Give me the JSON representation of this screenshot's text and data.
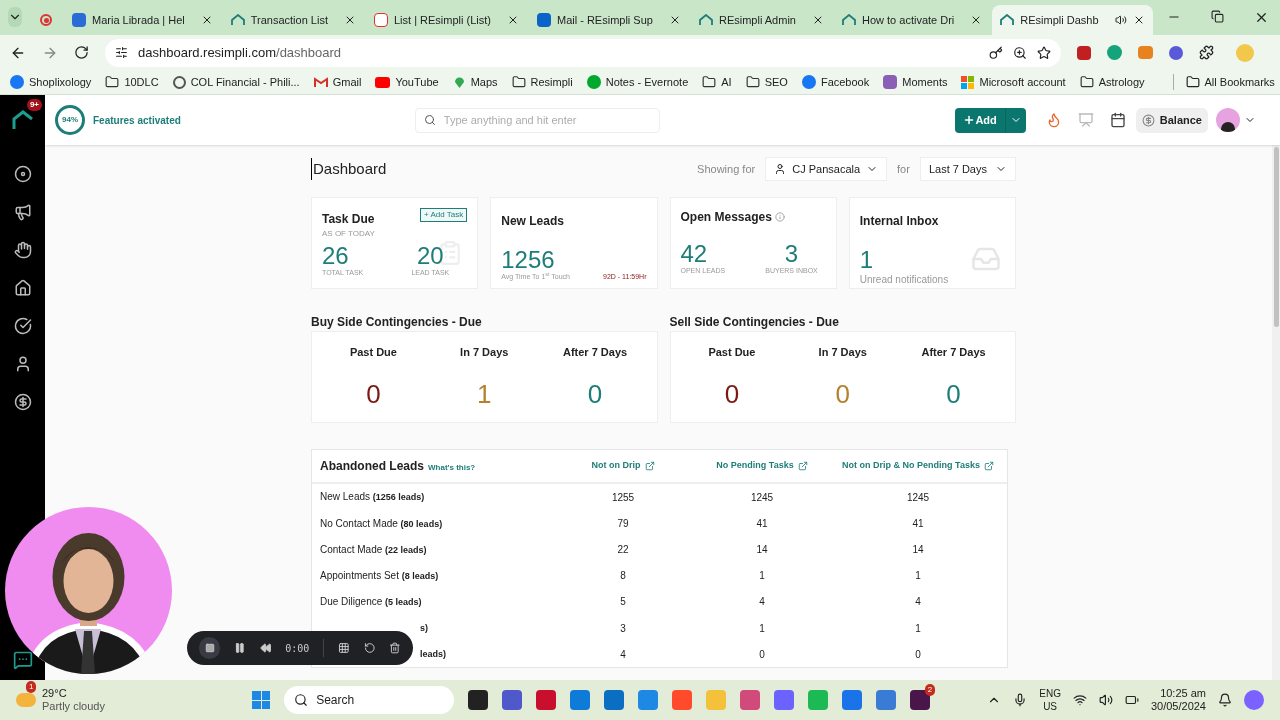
{
  "browser": {
    "tabs": [
      {
        "kind": "record",
        "selected": false
      },
      {
        "title": "Maria Librada | Hel",
        "kind": "help",
        "selected": false
      },
      {
        "title": "Transaction List",
        "kind": "resimpli",
        "selected": false
      },
      {
        "title": "List | REsimpli (List)",
        "kind": "list",
        "selected": false
      },
      {
        "title": "Mail - REsimpli Sup",
        "kind": "mail",
        "selected": false
      },
      {
        "title": "REsimpli Admin",
        "kind": "resimpli",
        "selected": false
      },
      {
        "title": "How to activate Dri",
        "kind": "resimpli",
        "selected": false
      },
      {
        "title": "REsimpli Dashb",
        "kind": "resimpli",
        "selected": true
      }
    ],
    "url_host": "dashboard.resimpli.com",
    "url_path": "/dashboard",
    "bookmarks": [
      {
        "label": "Shoplixology",
        "kind": "facebook"
      },
      {
        "label": "10DLC",
        "kind": "folder"
      },
      {
        "label": "COL Financial - Phili...",
        "kind": "site"
      },
      {
        "label": "Gmail",
        "kind": "gmail"
      },
      {
        "label": "YouTube",
        "kind": "youtube"
      },
      {
        "label": "Maps",
        "kind": "maps"
      },
      {
        "label": "Resimpli",
        "kind": "folder"
      },
      {
        "label": "Notes - Evernote",
        "kind": "evernote"
      },
      {
        "label": "AI",
        "kind": "folder"
      },
      {
        "label": "SEO",
        "kind": "folder"
      },
      {
        "label": "Facebook",
        "kind": "facebook"
      },
      {
        "label": "Moments",
        "kind": "moments"
      },
      {
        "label": "Microsoft account",
        "kind": "microsoft"
      },
      {
        "label": "Astrology",
        "kind": "folder"
      }
    ],
    "all_bookmarks": "All Bookmarks"
  },
  "app": {
    "badge": "9+",
    "progress_text": "94%",
    "features": "Features activated",
    "search_placeholder": "Type anything and hit enter",
    "add_button": "Add",
    "balance": "Balance"
  },
  "dashboard": {
    "title": "Dashboard",
    "showing_for": "Showing for",
    "user": "CJ Pansacala",
    "for": "for",
    "period": "Last 7 Days"
  },
  "cards": {
    "task_due": {
      "title": "Task Due",
      "add_task": "+ Add Task",
      "as_of": "AS OF TODAY",
      "total": "26",
      "total_label": "TOTAL TASK",
      "lead": "20",
      "lead_label": "LEAD TASK"
    },
    "new_leads": {
      "title": "New Leads",
      "value": "1256",
      "avg_label": "Avg Time To 1$^{st}$ Touch",
      "time": "92D - 11:59Hr"
    },
    "open_messages": {
      "title": "Open Messages",
      "value1": "42",
      "label1": "OPEN LEADS",
      "value2": "3",
      "label2": "BUYERS INBOX"
    },
    "internal_inbox": {
      "title": "Internal Inbox",
      "value": "1",
      "label": "Unread notifications"
    }
  },
  "contingencies": [
    {
      "title": "Buy Side Contingencies - Due",
      "columns": [
        {
          "label": "Past Due",
          "value": "0",
          "color": "#7a1a12"
        },
        {
          "label": "In 7 Days",
          "value": "1",
          "color": "#b5812f"
        },
        {
          "label": "After 7 Days",
          "value": "0",
          "color": "#1d7d78"
        }
      ]
    },
    {
      "title": "Sell Side Contingencies - Due",
      "columns": [
        {
          "label": "Past Due",
          "value": "0",
          "color": "#7a1a12"
        },
        {
          "label": "In 7 Days",
          "value": "0",
          "color": "#b5812f"
        },
        {
          "label": "After 7 Days",
          "value": "0",
          "color": "#1d7d78"
        }
      ]
    }
  ],
  "abandoned": {
    "title": "Abandoned Leads",
    "whats_this": "What's this?",
    "columns": [
      "Not on Drip",
      "No Pending Tasks",
      "Not on Drip & No Pending Tasks"
    ],
    "rows": [
      {
        "name": "New Leads",
        "count": "(1256 leads)",
        "values": [
          "1255",
          "1245",
          "1245"
        ]
      },
      {
        "name": "No Contact Made",
        "count": "(80 leads)",
        "values": [
          "79",
          "41",
          "41"
        ]
      },
      {
        "name": "Contact Made",
        "count": "(22 leads)",
        "values": [
          "22",
          "14",
          "14"
        ]
      },
      {
        "name": "Appointments Set",
        "count": "(8 leads)",
        "values": [
          "8",
          "1",
          "1"
        ]
      },
      {
        "name": "Due Diligence",
        "count": "(5 leads)",
        "values": [
          "5",
          "4",
          "4"
        ]
      },
      {
        "count": "s)",
        "values": [
          "3",
          "1",
          "1"
        ]
      },
      {
        "count": "leads)",
        "values": [
          "4",
          "0",
          "0"
        ]
      }
    ]
  },
  "recorder": {
    "time": "0:00"
  },
  "taskbar": {
    "alert": "1",
    "temperature": "29°C",
    "weather": "Partly cloudy",
    "search": "Search",
    "slack_badge": "2",
    "lang": "ENG",
    "region": "US",
    "time": "10:25 am",
    "date": "30/05/2024"
  }
}
